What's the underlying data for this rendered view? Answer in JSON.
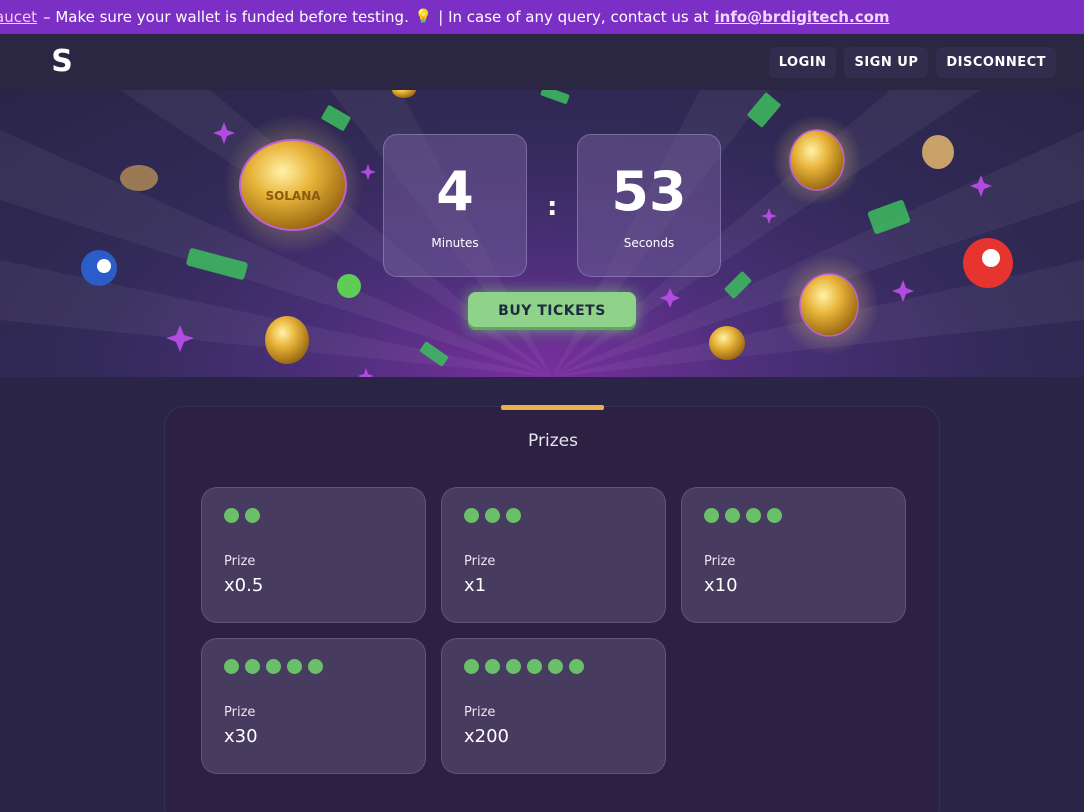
{
  "announcement": {
    "faucet_link": "aucet",
    "message": "– Make sure your wallet is funded before testing.",
    "bulb_icon": "lightbulb-icon",
    "contact_text": "| In case of any query, contact us at",
    "email": "info@brdigitech.com"
  },
  "nav": {
    "logo": "S",
    "login": "LOGIN",
    "signup": "SIGN UP",
    "disconnect": "DISCONNECT"
  },
  "timer": {
    "minutes_value": "4",
    "minutes_label": "Minutes",
    "seconds_value": "53",
    "seconds_label": "Seconds",
    "separator": ":"
  },
  "cta": {
    "buy_tickets": "BUY TICKETS"
  },
  "prizes": {
    "title": "Prizes",
    "cards": [
      {
        "balls": 2,
        "label": "Prize",
        "value": "x0.5"
      },
      {
        "balls": 3,
        "label": "Prize",
        "value": "x1"
      },
      {
        "balls": 4,
        "label": "Prize",
        "value": "x10"
      },
      {
        "balls": 5,
        "label": "Prize",
        "value": "x30"
      },
      {
        "balls": 6,
        "label": "Prize",
        "value": "x200"
      }
    ]
  },
  "colors": {
    "announcement_bg": "#7b2fc4",
    "buy_button": "#8fd38a",
    "ball_green": "#6abf69",
    "accent_gold": "#e8b04a"
  }
}
